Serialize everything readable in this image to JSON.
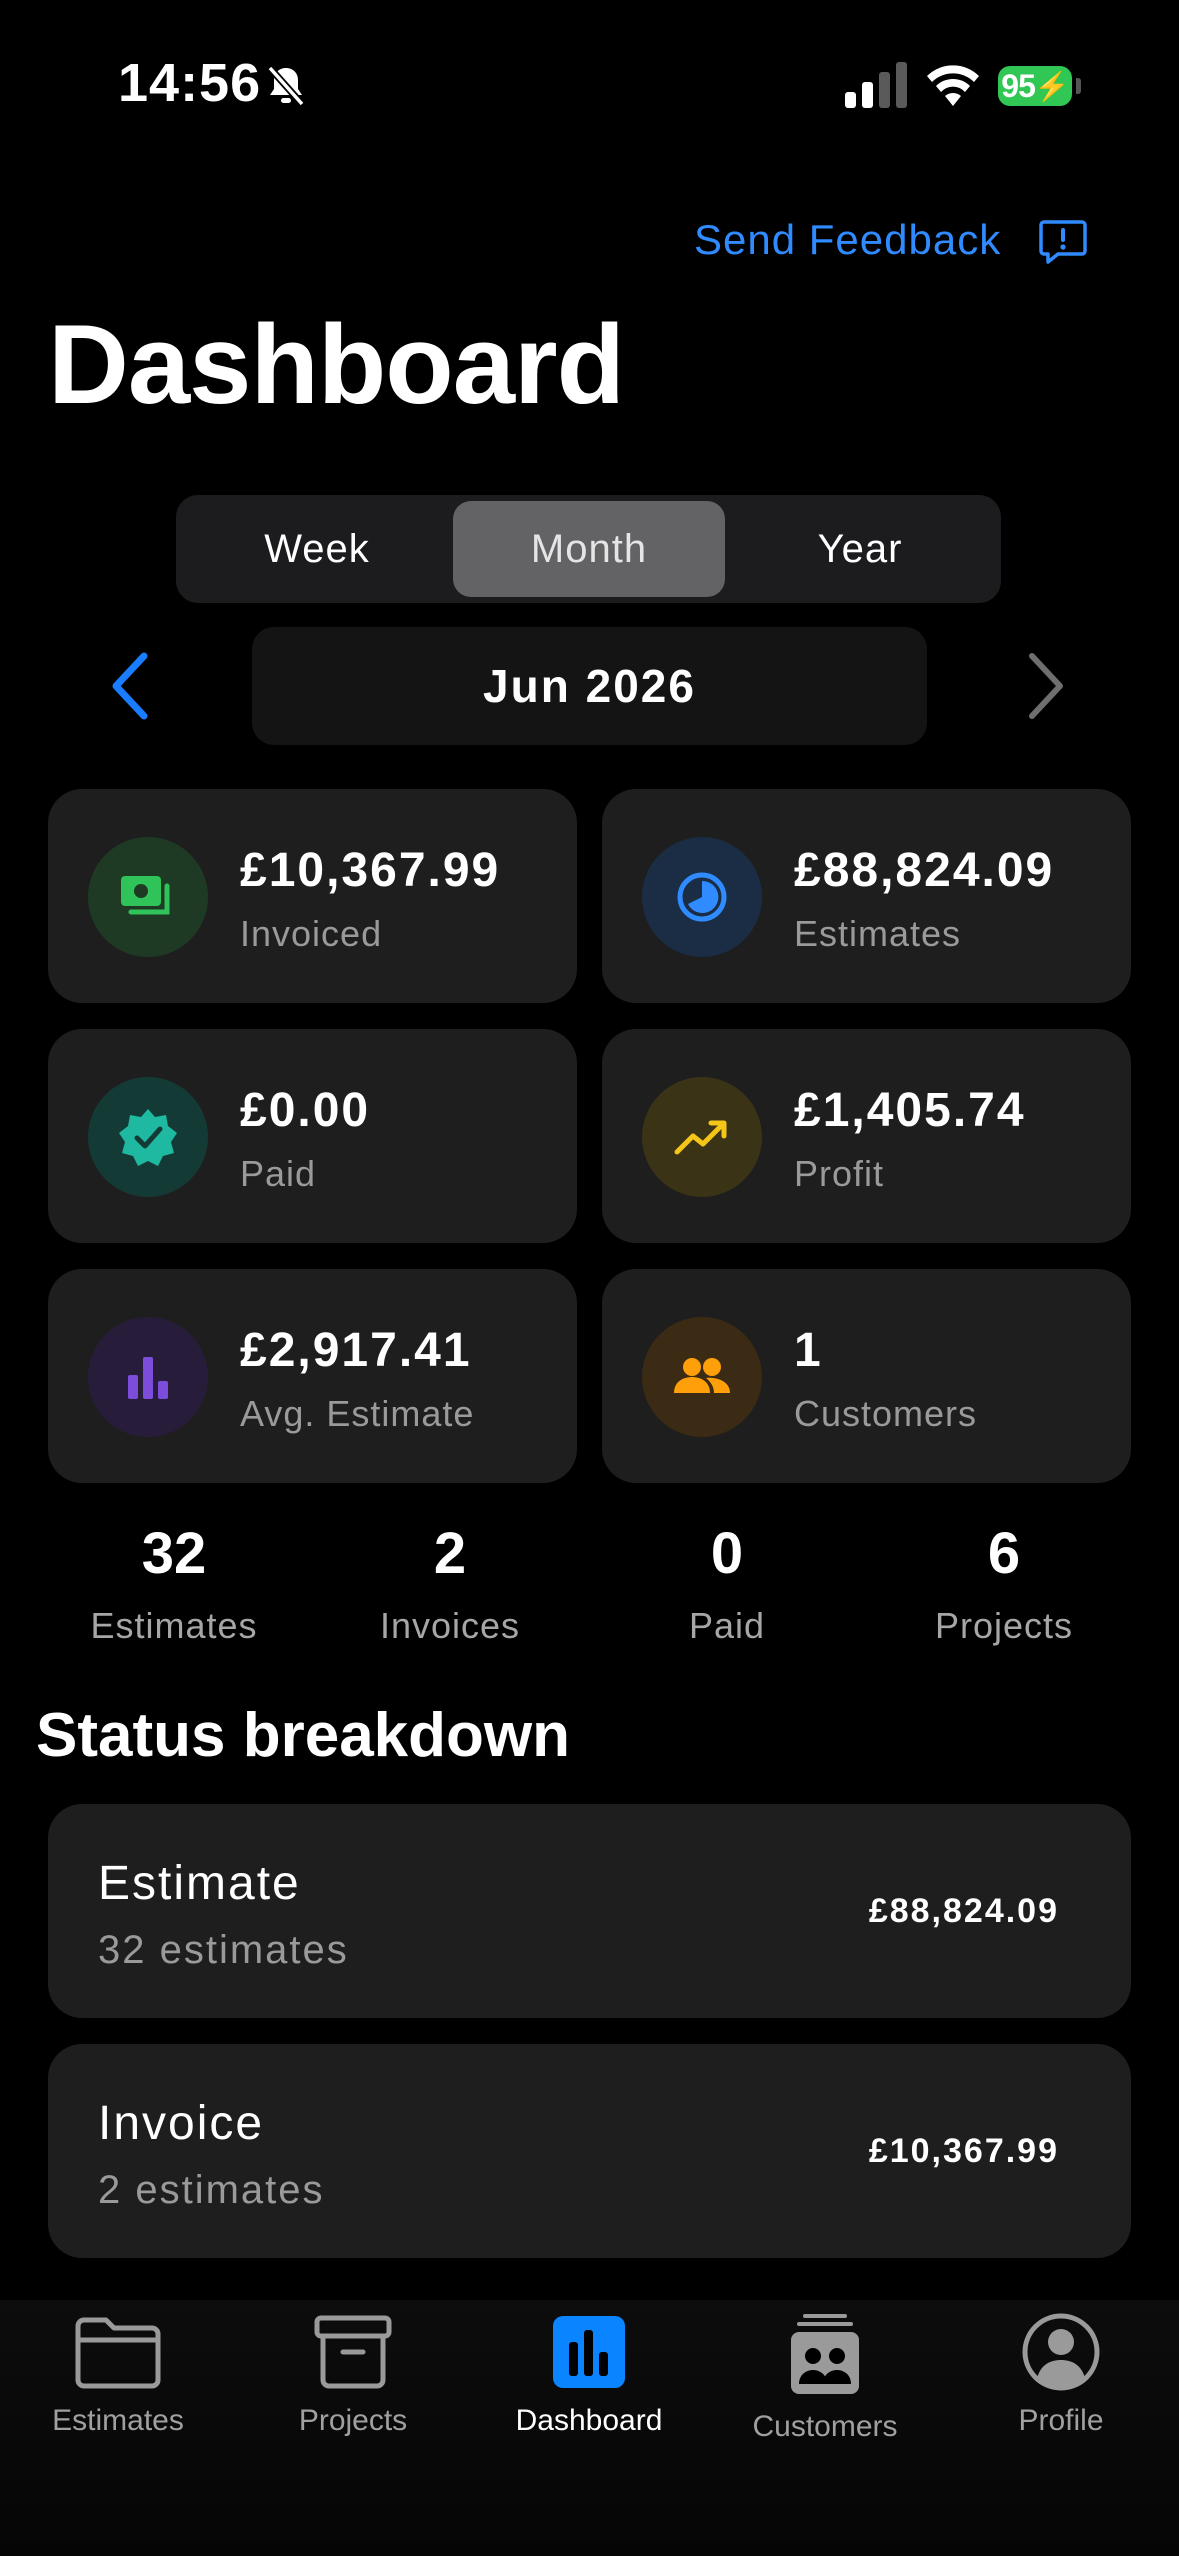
{
  "status_bar": {
    "time": "14:56",
    "battery": "95"
  },
  "header": {
    "feedback_label": "Send Feedback",
    "title": "Dashboard"
  },
  "period_selector": {
    "options": [
      "Week",
      "Month",
      "Year"
    ],
    "selected": "Month",
    "current": "Jun 2026"
  },
  "metrics": [
    {
      "value": "£10,367.99",
      "label": "Invoiced",
      "icon": "banknote-icon",
      "color": "#30c35a"
    },
    {
      "value": "£88,824.09",
      "label": "Estimates",
      "icon": "pie-chart-icon",
      "color": "#2f8bff"
    },
    {
      "value": "£0.00",
      "label": "Paid",
      "icon": "verified-check-icon",
      "color": "#1fb8a0"
    },
    {
      "value": "£1,405.74",
      "label": "Profit",
      "icon": "trending-up-icon",
      "color": "#f5c518"
    },
    {
      "value": "£2,917.41",
      "label": "Avg. Estimate",
      "icon": "bar-chart-icon",
      "color": "#7c4ddb"
    },
    {
      "value": "1",
      "label": "Customers",
      "icon": "people-icon",
      "color": "#ff9f0a"
    }
  ],
  "counts": [
    {
      "num": "32",
      "label": "Estimates"
    },
    {
      "num": "2",
      "label": "Invoices"
    },
    {
      "num": "0",
      "label": "Paid"
    },
    {
      "num": "6",
      "label": "Projects"
    }
  ],
  "status_breakdown": {
    "title": "Status breakdown",
    "items": [
      {
        "name": "Estimate",
        "sub": "32 estimates",
        "amount": "£88,824.09"
      },
      {
        "name": "Invoice",
        "sub": "2 estimates",
        "amount": "£10,367.99"
      }
    ]
  },
  "tabs": [
    {
      "label": "Estimates",
      "icon": "folder-icon"
    },
    {
      "label": "Projects",
      "icon": "archive-box-icon"
    },
    {
      "label": "Dashboard",
      "icon": "dashboard-chart-icon",
      "active": true
    },
    {
      "label": "Customers",
      "icon": "contacts-icon"
    },
    {
      "label": "Profile",
      "icon": "person-circle-icon"
    }
  ],
  "colors": {
    "accent": "#0a84ff",
    "background": "#000000",
    "card": "#1e1e1e"
  }
}
